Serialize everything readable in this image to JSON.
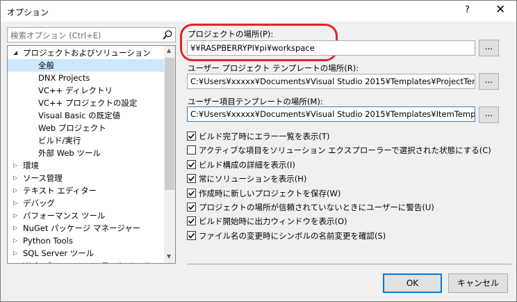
{
  "window": {
    "title": "オプション",
    "help": "?",
    "close": "✕"
  },
  "search": {
    "placeholder": "検索オプション (Ctrl+E)"
  },
  "tree": {
    "expanded_arrow": "◢",
    "collapsed_arrow": "▷",
    "items": [
      {
        "label": "プロジェクトおよびソリューション",
        "level": 0,
        "expander": "expanded"
      },
      {
        "label": "全般",
        "level": 1,
        "selected": true
      },
      {
        "label": "DNX Projects",
        "level": 1
      },
      {
        "label": "VC++ ディレクトリ",
        "level": 1
      },
      {
        "label": "VC++ プロジェクトの設定",
        "level": 1
      },
      {
        "label": "Visual Basic の既定値",
        "level": 1
      },
      {
        "label": "Web プロジェクト",
        "level": 1
      },
      {
        "label": "ビルド/実行",
        "level": 1
      },
      {
        "label": "外部 Web ツール",
        "level": 1
      },
      {
        "label": "環境",
        "level": 0,
        "expander": "collapsed"
      },
      {
        "label": "ソース管理",
        "level": 0,
        "expander": "collapsed"
      },
      {
        "label": "テキスト エディター",
        "level": 0,
        "expander": "collapsed"
      },
      {
        "label": "デバッグ",
        "level": 0,
        "expander": "collapsed"
      },
      {
        "label": "パフォーマンス ツール",
        "level": 0,
        "expander": "collapsed"
      },
      {
        "label": "NuGet パッケージ マネージャー",
        "level": 0,
        "expander": "collapsed"
      },
      {
        "label": "Python Tools",
        "level": 0,
        "expander": "collapsed"
      },
      {
        "label": "SQL Server ツール",
        "level": 0,
        "expander": "collapsed"
      },
      {
        "label": "Web パフォーマンス テスト ツール",
        "level": 0,
        "expander": "collapsed"
      }
    ]
  },
  "fields": {
    "project_location": {
      "label": "プロジェクトの場所(P):",
      "value": "¥¥RASPBERRYPI¥pi¥workspace"
    },
    "template_location": {
      "label": "ユーザー プロジェクト テンプレートの場所(R):",
      "value": "C:¥Users¥xxxxx¥Documents¥Visual Studio 2015¥Templates¥ProjectTemplates"
    },
    "item_template_location": {
      "label": "ユーザー項目テンプレートの場所(M):",
      "value": "C:¥Users¥xxxxx¥Documents¥Visual Studio 2015¥Templates¥ItemTemplates"
    },
    "browse_label": "..."
  },
  "checkboxes": [
    {
      "label": "ビルド完了時にエラー一覧を表示(T)",
      "checked": true
    },
    {
      "label": "アクティブな項目をソリューション エクスプローラーで選択された状態にする(C)",
      "checked": false
    },
    {
      "label": "ビルド構成の詳細を表示(I)",
      "checked": true
    },
    {
      "label": "常にソリューションを表示(H)",
      "checked": true
    },
    {
      "label": "作成時に新しいプロジェクトを保存(W)",
      "checked": true
    },
    {
      "label": "プロジェクトの場所が信頼されていないときにユーザーに警告(U)",
      "checked": true
    },
    {
      "label": "ビルド開始時に出力ウィンドウを表示(O)",
      "checked": true
    },
    {
      "label": "ファイル名の変更時にシンボルの名前変更を確認(S)",
      "checked": true
    }
  ],
  "buttons": {
    "ok": "OK",
    "cancel": "キャンセル"
  },
  "colors": {
    "highlight": "#e2242b",
    "selected": "#cce8ff",
    "accent": "#0078d7"
  }
}
